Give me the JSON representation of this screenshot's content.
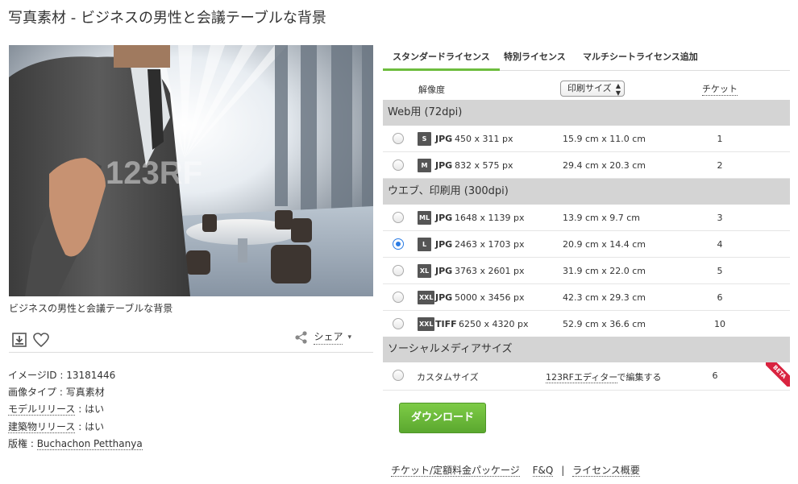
{
  "title": "写真素材 - ビジネスの男性と会議テーブルな背景",
  "photo": {
    "watermark": "123RF",
    "alt_icon": "business-man-handshake-photo"
  },
  "caption": "ビジネスの男性と会議テーブルな背景",
  "actions": {
    "download_icon": "download-icon",
    "favorite_icon": "heart-icon",
    "share_label": "シェア",
    "share_arrow": "▾"
  },
  "meta": {
    "image_id_label": "イメージID",
    "image_id": "13181446",
    "type_label": "画像タイプ",
    "type": "写真素材",
    "model_label": "モデルリリース",
    "model": "はい",
    "property_label": "建築物リリース",
    "property": "はい",
    "copyright_label": "版権",
    "copyright": "Buchachon Petthanya",
    "sep": " : "
  },
  "tabs": [
    {
      "label": "スタンダードライセンス",
      "active": true
    },
    {
      "label": "特別ライセンス",
      "active": false
    },
    {
      "label": "マルチシートライセンス追加",
      "active": false
    }
  ],
  "table_header": {
    "resolution": "解像度",
    "size_select": "印刷サイズ",
    "ticket": "チケット"
  },
  "sections": {
    "web": "Web用 (72dpi)",
    "print": "ウエブ、印刷用 (300dpi)",
    "social": "ソーシャルメディアサイズ"
  },
  "rows": [
    {
      "badge": "S",
      "format": "JPG",
      "px": "450 x 311 px",
      "cm": "15.9 cm x 11.0 cm",
      "ticket": "1",
      "selected": false
    },
    {
      "badge": "M",
      "format": "JPG",
      "px": "832 x 575 px",
      "cm": "29.4 cm x 20.3 cm",
      "ticket": "2",
      "selected": false
    },
    {
      "badge": "ML",
      "format": "JPG",
      "px": "1648 x 1139 px",
      "cm": "13.9 cm x 9.7 cm",
      "ticket": "3",
      "selected": false
    },
    {
      "badge": "L",
      "format": "JPG",
      "px": "2463 x 1703 px",
      "cm": "20.9 cm x 14.4 cm",
      "ticket": "4",
      "selected": true
    },
    {
      "badge": "XL",
      "format": "JPG",
      "px": "3763 x 2601 px",
      "cm": "31.9 cm x 22.0 cm",
      "ticket": "5",
      "selected": false
    },
    {
      "badge": "XXL",
      "format": "JPG",
      "px": "5000 x 3456 px",
      "cm": "42.3 cm x 29.3 cm",
      "ticket": "6",
      "selected": false
    },
    {
      "badge": "XXL",
      "format": "TIFF",
      "px": "6250 x 4320 px",
      "cm": "52.9 cm x 36.6 cm",
      "ticket": "10",
      "selected": false
    }
  ],
  "custom": {
    "label": "カスタムサイズ",
    "editor_link": "123RFエディター",
    "editor_suffix": "で編集する",
    "ticket": "6",
    "beta": "BETA"
  },
  "download_button": "ダウンロード",
  "footer": {
    "link1": "チケット/定額料金パッケージ",
    "link2": "F&Q",
    "sep": "|",
    "link3": "ライセンス概要"
  },
  "colors": {
    "accent_green": "#6dbd3e",
    "radio_blue": "#2a7be4",
    "beta_red": "#d9233f",
    "section_gray": "#d4d4d4"
  }
}
